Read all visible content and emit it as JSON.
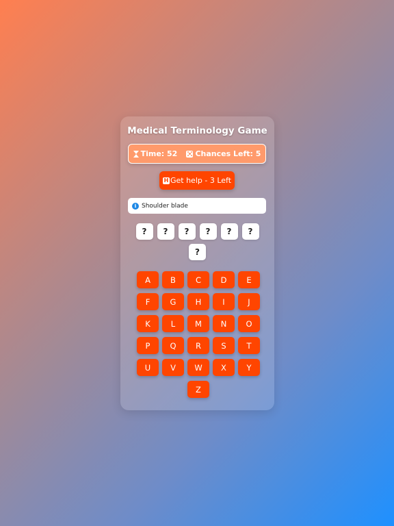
{
  "game": {
    "title": "Medical Terminology Game",
    "status": {
      "time_label": "Time: 52",
      "chances_label": "Chances Left: 5"
    },
    "help_button": "Get help - 3 Left",
    "hint": "Shoulder blade",
    "word_slots": [
      "?",
      "?",
      "?",
      "?",
      "?",
      "?",
      "?"
    ],
    "keys": [
      "A",
      "B",
      "C",
      "D",
      "E",
      "F",
      "G",
      "H",
      "I",
      "J",
      "K",
      "L",
      "M",
      "N",
      "O",
      "P",
      "Q",
      "R",
      "S",
      "T",
      "U",
      "V",
      "W",
      "X",
      "Y",
      "Z"
    ]
  },
  "icons": {
    "timer": "hourglass-icon",
    "chances": "dice-icon",
    "help": "help-icon",
    "hint": "info-icon"
  },
  "colors": {
    "accent": "#ff4500",
    "status_bg": "#ff9a6b",
    "info": "#1e88e5"
  }
}
